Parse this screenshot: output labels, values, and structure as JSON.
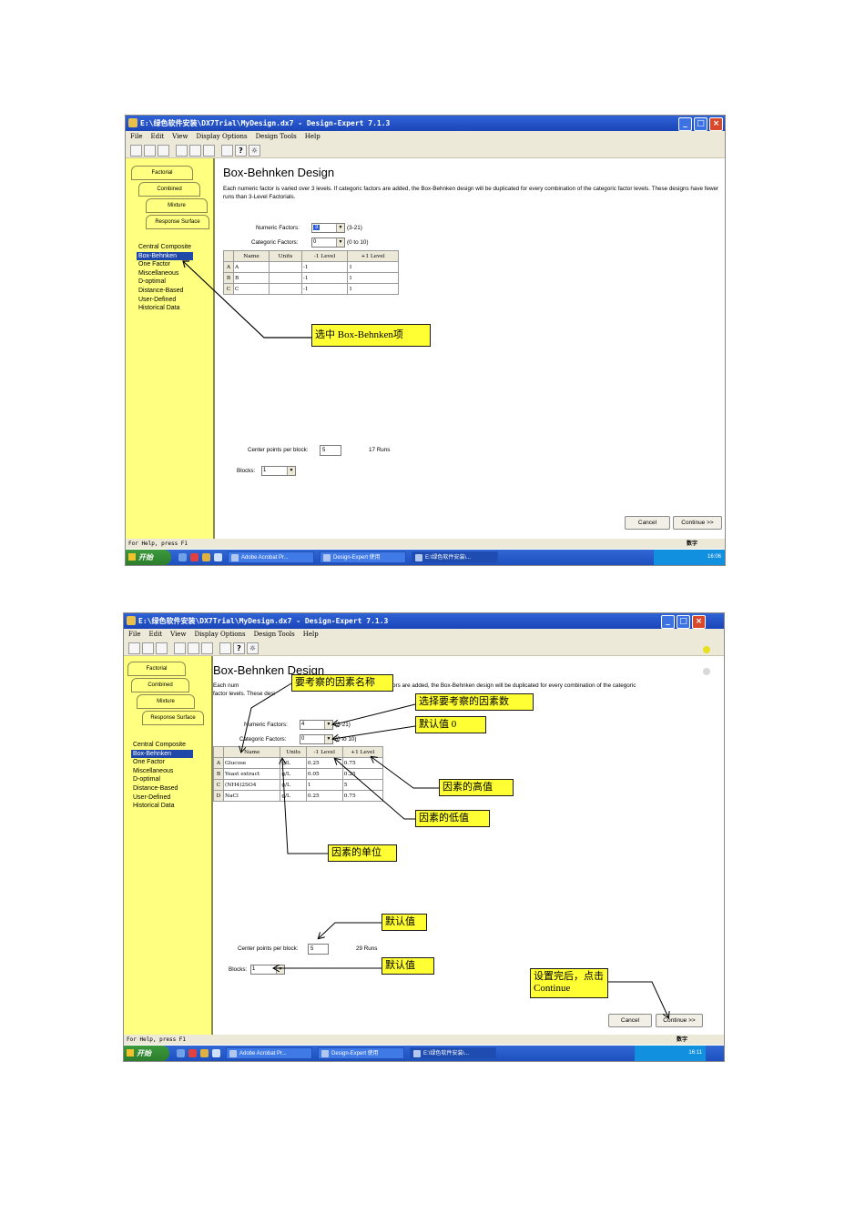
{
  "shot1": {
    "window_title": "E:\\绿色软件安装\\DX7Trial\\MyDesign.dx7 - Design-Expert 7.1.3",
    "menu": [
      "File",
      "Edit",
      "View",
      "Display Options",
      "Design Tools",
      "Help"
    ],
    "tabs": [
      "Factorial",
      "Combined",
      "Mixture",
      "Response Surface"
    ],
    "design_list": [
      "Central Composite",
      "Box-Behnken",
      "One Factor",
      "Miscellaneous",
      "D-optimal",
      "Distance-Based",
      "User-Defined",
      "Historical Data"
    ],
    "selected_design": "Box-Behnken",
    "design_title": "Box-Behnken Design",
    "description": "Each numeric factor is varied over 3 levels.  If categoric factors are added, the Box-Behnken design will be duplicated for every combination of the categoric factor levels.  These designs have fewer runs than 3-Level Factorials.",
    "numeric_label": "Numeric Factors:",
    "numeric_value": "3",
    "numeric_range": "(3-21)",
    "categoric_label": "Categoric Factors:",
    "categoric_value": "0",
    "categoric_range": "(0 to 10)",
    "columns": [
      "Name",
      "Units",
      "-1 Level",
      "+1 Level"
    ],
    "rows": [
      {
        "id": "A",
        "name": "A",
        "units": "",
        "low": "-1",
        "high": "1"
      },
      {
        "id": "B",
        "name": "B",
        "units": "",
        "low": "-1",
        "high": "1"
      },
      {
        "id": "C",
        "name": "C",
        "units": "",
        "low": "-1",
        "high": "1"
      }
    ],
    "center_label": "Center points per block:",
    "center_value": "5",
    "runs_text": "17  Runs",
    "blocks_label": "Blocks:",
    "blocks_value": "1",
    "cancel_label": "Cancel",
    "continue_label": "Continue >>",
    "status_text": "For Help, press F1",
    "status_num": "数字",
    "start_label": "开始",
    "tasks": [
      "Adobe Acrobat Pr...",
      "Design-Expert 使用",
      "E:\\绿色软件安装\\..."
    ],
    "tray_time": "16:06",
    "callout": "选中 Box-Behnken项"
  },
  "shot2": {
    "window_title": "E:\\绿色软件安装\\DX7Trial\\MyDesign.dx7 - Design-Expert 7.1.3",
    "menu": [
      "File",
      "Edit",
      "View",
      "Display Options",
      "Design Tools",
      "Help"
    ],
    "tabs": [
      "Factorial",
      "Combined",
      "Mixture",
      "Response Surface"
    ],
    "design_list": [
      "Central Composite",
      "Box-Behnken",
      "One Factor",
      "Miscellaneous",
      "D-optimal",
      "Distance-Based",
      "User-Defined",
      "Historical Data"
    ],
    "selected_design": "Box-Behnken",
    "design_title": "Box-Behnken Design",
    "description_a": "Each num",
    "description_b": "ors are added, the Box-Behnken design will be duplicated for every combination of the categoric",
    "description_c": "factor levels.  These desi",
    "numeric_label": "Numeric Factors:",
    "numeric_value": "4",
    "numeric_range": "(3-21)",
    "categoric_label": "Categoric Factors:",
    "categoric_value": "0",
    "categoric_range": "(0 to 10)",
    "columns": [
      "Name",
      "Units",
      "-1 Level",
      "+1 Level"
    ],
    "rows": [
      {
        "id": "A",
        "name": "Glucose",
        "units": "g/L",
        "low": "0.25",
        "high": "0.75"
      },
      {
        "id": "B",
        "name": "Yeast extract",
        "units": "g/L",
        "low": "0.05",
        "high": "0.25"
      },
      {
        "id": "C",
        "name": "(NH4)2SO4",
        "units": "g/L",
        "low": "1",
        "high": "5"
      },
      {
        "id": "D",
        "name": "NaCl",
        "units": "g/L",
        "low": "0.25",
        "high": "0.75"
      }
    ],
    "center_label": "Center points per block:",
    "center_value": "5",
    "runs_text": "29  Runs",
    "blocks_label": "Blocks:",
    "blocks_value": "1",
    "cancel_label": "Cancel",
    "continue_label": "Continue >>",
    "status_text": "For Help, press F1",
    "status_num": "数字",
    "start_label": "开始",
    "tasks": [
      "Adobe Acrobat Pr...",
      "Design-Expert 使用",
      "E:\\绿色软件安装\\..."
    ],
    "tray_time": "16:11",
    "callouts": {
      "factor_name": "要考察的因素名称",
      "factor_count": "选择要考察的因素数",
      "default_zero": "默认值 0",
      "high_value": "因素的高值",
      "low_value": "因素的低值",
      "units": "因素的单位",
      "default_center": "默认值",
      "default_blocks": "默认值",
      "continue_hint": "设置完后，点击Continue"
    }
  }
}
